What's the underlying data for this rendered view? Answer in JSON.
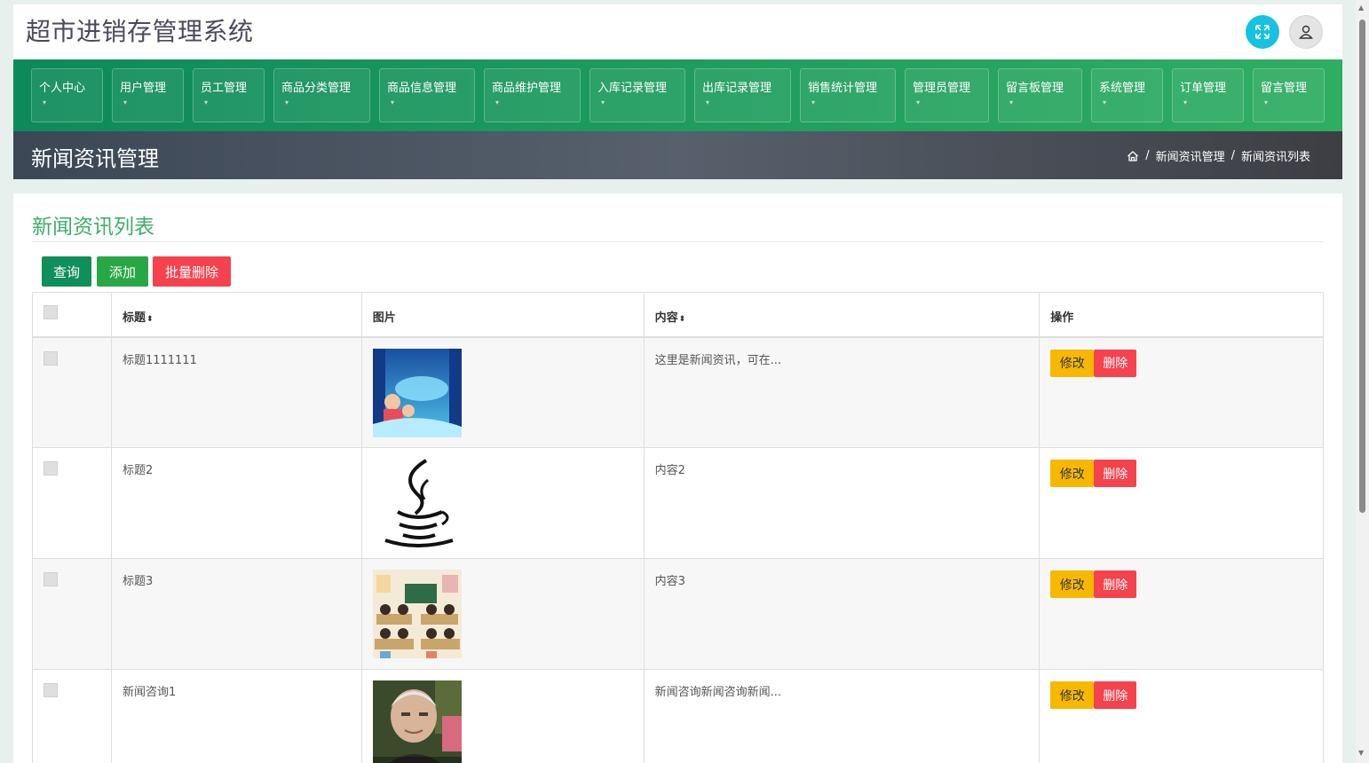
{
  "app": {
    "title": "超市进销存管理系统"
  },
  "topbar": {
    "fullscreen_icon": "expand-icon",
    "user_icon": "user-icon"
  },
  "nav": [
    {
      "label": "个人中心"
    },
    {
      "label": "用户管理"
    },
    {
      "label": "员工管理"
    },
    {
      "label": "商品分类管理"
    },
    {
      "label": "商品信息管理"
    },
    {
      "label": "商品维护管理"
    },
    {
      "label": "入库记录管理"
    },
    {
      "label": "出库记录管理"
    },
    {
      "label": "销售统计管理"
    },
    {
      "label": "管理员管理"
    },
    {
      "label": "留言板管理"
    },
    {
      "label": "系统管理"
    },
    {
      "label": "订单管理"
    },
    {
      "label": "留言管理"
    }
  ],
  "page_header": {
    "title": "新闻资讯管理",
    "breadcrumb": [
      "新闻资讯管理",
      "新闻资讯列表"
    ]
  },
  "card": {
    "title": "新闻资讯列表",
    "buttons": {
      "query": "查询",
      "add": "添加",
      "batch_delete": "批量删除"
    }
  },
  "table": {
    "headers": {
      "title": "标题",
      "image": "图片",
      "content": "内容",
      "actions": "操作"
    },
    "sort_glyph": "⬍",
    "rows": [
      {
        "title": "标题1111111",
        "image": "poster",
        "content": "这里是新闻资讯，可在..."
      },
      {
        "title": "标题2",
        "image": "java-logo",
        "content": "内容2"
      },
      {
        "title": "标题3",
        "image": "classroom",
        "content": "内容3"
      },
      {
        "title": "新闻咨询1",
        "image": "portrait",
        "content": "新闻咨询新闻咨询新闻..."
      }
    ],
    "edit_label": "修改",
    "delete_label": "删除"
  },
  "colors": {
    "nav_start": "#0e8a5a",
    "nav_end": "#2fae62",
    "card_title": "#3bae6d",
    "edit": "#f6b800",
    "delete": "#f5424d"
  }
}
